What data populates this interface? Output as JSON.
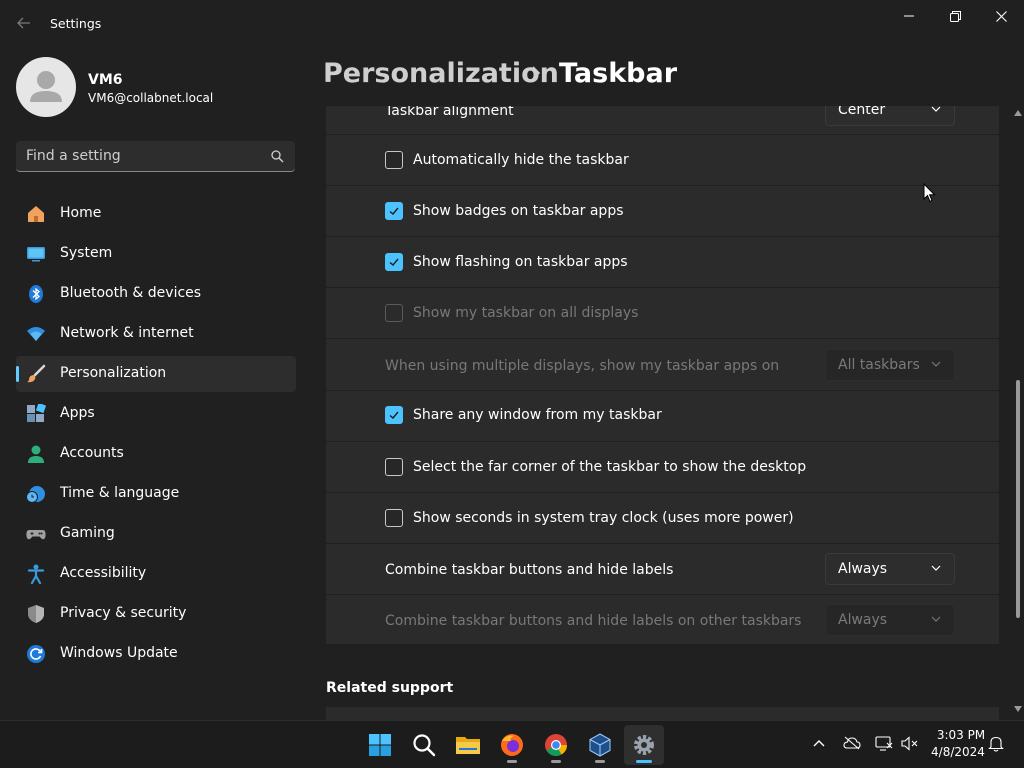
{
  "window": {
    "title": "Settings"
  },
  "user": {
    "name": "VM6",
    "email": "VM6@collabnet.local"
  },
  "search": {
    "placeholder": "Find a setting"
  },
  "nav": {
    "items": [
      {
        "label": "Home",
        "icon": "home-icon"
      },
      {
        "label": "System",
        "icon": "monitor-icon"
      },
      {
        "label": "Bluetooth & devices",
        "icon": "bluetooth-icon"
      },
      {
        "label": "Network & internet",
        "icon": "wifi-icon"
      },
      {
        "label": "Personalization",
        "icon": "brush-icon",
        "active": true
      },
      {
        "label": "Apps",
        "icon": "apps-icon"
      },
      {
        "label": "Accounts",
        "icon": "person-icon"
      },
      {
        "label": "Time & language",
        "icon": "clock-globe-icon"
      },
      {
        "label": "Gaming",
        "icon": "controller-icon"
      },
      {
        "label": "Accessibility",
        "icon": "accessibility-icon"
      },
      {
        "label": "Privacy & security",
        "icon": "shield-icon"
      },
      {
        "label": "Windows Update",
        "icon": "update-icon"
      }
    ]
  },
  "header": {
    "parent": "Personalization",
    "current": "Taskbar"
  },
  "settings": {
    "alignment": {
      "label": "Taskbar alignment",
      "value": "Center"
    },
    "auto_hide": {
      "label": "Automatically hide the taskbar",
      "checked": false
    },
    "badges": {
      "label": "Show badges on taskbar apps",
      "checked": true
    },
    "flashing": {
      "label": "Show flashing on taskbar apps",
      "checked": true
    },
    "all_displays": {
      "label": "Show my taskbar on all displays",
      "checked": false,
      "disabled": true
    },
    "multi_display": {
      "label": "When using multiple displays, show my taskbar apps on",
      "value": "All taskbars",
      "disabled": true
    },
    "share_window": {
      "label": "Share any window from my taskbar",
      "checked": true
    },
    "far_corner": {
      "label": "Select the far corner of the taskbar to show the desktop",
      "checked": false
    },
    "seconds": {
      "label": "Show seconds in system tray clock (uses more power)",
      "checked": false
    },
    "combine": {
      "label": "Combine taskbar buttons and hide labels",
      "value": "Always"
    },
    "combine_other": {
      "label": "Combine taskbar buttons and hide labels on other taskbars",
      "value": "Always",
      "disabled": true
    }
  },
  "related": {
    "title": "Related support"
  },
  "taskbar": {
    "apps": [
      "start-icon",
      "search-icon",
      "file-explorer-icon",
      "firefox-icon",
      "chrome-icon",
      "virtualbox-icon",
      "settings-gear-icon"
    ],
    "time": "3:03 PM",
    "date": "4/8/2024"
  },
  "colors": {
    "accent": "#4cc2ff",
    "background": "#202020",
    "card": "#2b2b2b"
  }
}
